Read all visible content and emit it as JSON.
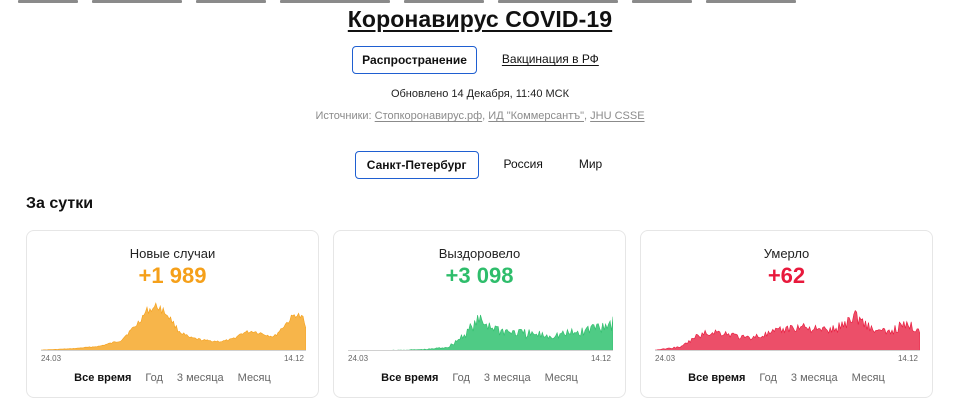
{
  "title": "Коронавирус COVID-19",
  "mode_tabs": [
    {
      "label": "Распространение",
      "active": true
    },
    {
      "label": "Вакцинация в РФ",
      "active": false
    }
  ],
  "updated": "Обновлено 14 Декабря, 11:40 МСК",
  "sources": {
    "prefix": "Источники:",
    "links": [
      "Стопкоронавирус.рф",
      "ИД \"Коммерсантъ\"",
      "JHU CSSE"
    ]
  },
  "region_tabs": [
    {
      "label": "Санкт-Петербург",
      "active": true
    },
    {
      "label": "Россия",
      "active": false
    },
    {
      "label": "Мир",
      "active": false
    }
  ],
  "section_title": "За сутки",
  "colors": {
    "accent": "#1f5fd1",
    "cases": "#f5a01a",
    "recovered": "#2ebd6b",
    "deaths": "#e8193c"
  },
  "cards": [
    {
      "label": "Новые случаи",
      "value": "+1 989",
      "color": "#f5a01a",
      "fill": "#f7b54a",
      "date_start": "24.03",
      "date_end": "14.12",
      "ranges": [
        "Все время",
        "Год",
        "3 месяца",
        "Месяц"
      ],
      "active_range": "Все время"
    },
    {
      "label": "Выздоровело",
      "value": "+3 098",
      "color": "#2ebd6b",
      "fill": "#4fcb85",
      "date_start": "24.03",
      "date_end": "14.12",
      "ranges": [
        "Все время",
        "Год",
        "3 месяца",
        "Месяц"
      ],
      "active_range": "Все время"
    },
    {
      "label": "Умерло",
      "value": "+62",
      "color": "#e8193c",
      "fill": "#ec4f69",
      "date_start": "24.03",
      "date_end": "14.12",
      "ranges": [
        "Все время",
        "Год",
        "3 месяца",
        "Месяц"
      ],
      "active_range": "Все время"
    }
  ]
}
